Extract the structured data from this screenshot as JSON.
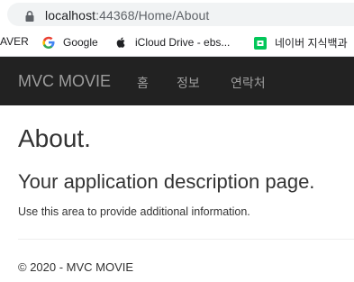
{
  "browser": {
    "url_host": "localhost",
    "url_rest_host": ":44368",
    "url_path": "/Home/About",
    "bookmarks": [
      {
        "label": "AVER",
        "icon": "naver-icon"
      },
      {
        "label": "Google",
        "icon": "google-icon"
      },
      {
        "label": "iCloud Drive - ebs...",
        "icon": "apple-icon"
      },
      {
        "label": "네이버 지식백과",
        "icon": "naver-dictionary-icon"
      }
    ]
  },
  "navbar": {
    "brand": "MVC MOVIE",
    "items": [
      {
        "label": "홈"
      },
      {
        "label": "정보"
      },
      {
        "label": "연락처"
      }
    ]
  },
  "page": {
    "title": "About.",
    "subtitle": "Your application description page.",
    "description": "Use this area to provide additional information.",
    "footer": "© 2020 - MVC MOVIE"
  },
  "colors": {
    "navbar_bg": "#222222",
    "nav_text": "#9d9d9d",
    "body_text": "#333333",
    "naver_green": "#03c75a"
  }
}
